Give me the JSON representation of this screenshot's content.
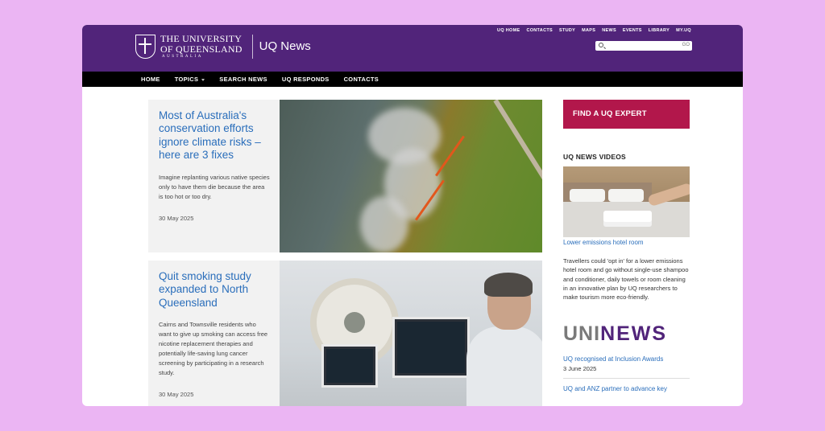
{
  "header": {
    "uni_line1": "THE UNIVERSITY",
    "uni_line2": "OF QUEENSLAND",
    "uni_line3": "AUSTRALIA",
    "site_title": "UQ News",
    "top_links": [
      "UQ HOME",
      "CONTACTS",
      "STUDY",
      "MAPS",
      "NEWS",
      "EVENTS",
      "LIBRARY",
      "MY.UQ"
    ],
    "search_go": "GO"
  },
  "nav": {
    "items": [
      "HOME",
      "TOPICS",
      "SEARCH NEWS",
      "UQ RESPONDS",
      "CONTACTS"
    ]
  },
  "articles": [
    {
      "title": "Most of Australia's conservation efforts ignore climate risks – here are 3 fixes",
      "summary": "Imagine replanting various native species only to have them die because the area is too hot or too dry.",
      "date": "30 May 2025"
    },
    {
      "title": "Quit smoking study expanded to North Queensland",
      "summary": "Cairns and Townsville residents who want to give up smoking can access free nicotine replacement therapies and potentially life-saving lung cancer screening by participating in a research study.",
      "date": "30 May 2025"
    }
  ],
  "sidebar": {
    "expert_button": "FIND A UQ EXPERT",
    "videos_heading": "UQ NEWS VIDEOS",
    "video_title": "Lower emissions hotel room",
    "video_description": "Travellers could 'opt in' for a lower emissions hotel room and go without single-use shampoo and conditioner, daily towels or room cleaning in an innovative plan by UQ researchers to make tourism more eco-friendly.",
    "uninews_uni": "UNI",
    "uninews_news": "NEWS",
    "news_items": [
      {
        "title": "UQ recognised at Inclusion Awards",
        "date": "3 June 2025"
      },
      {
        "title": "UQ and ANZ partner to advance key",
        "date": ""
      }
    ]
  },
  "colors": {
    "brand_purple": "#51247a",
    "accent_red": "#b2174b",
    "link_blue": "#2a6ebb",
    "page_background": "#ebb5f3"
  }
}
